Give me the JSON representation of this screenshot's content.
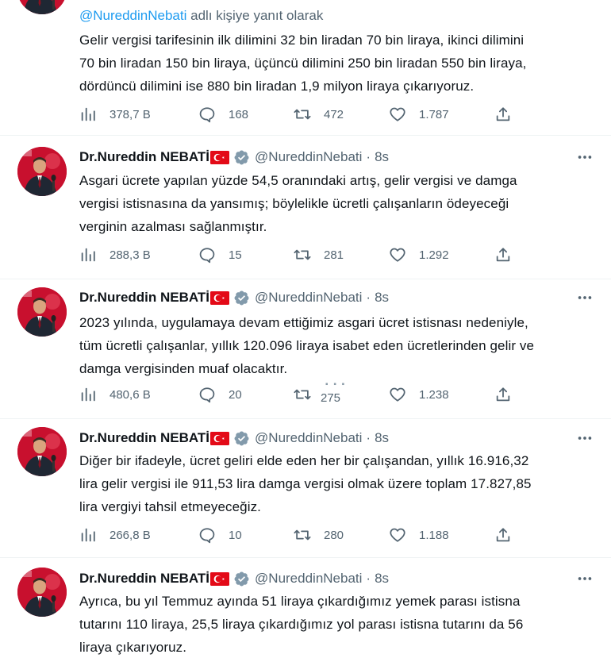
{
  "colors": {
    "accent": "#1d9bf0",
    "verified": "#829aab",
    "secondary_text": "#536471",
    "avatar_bg": "#c8102e",
    "flag_red": "#e30a17"
  },
  "tweets": [
    {
      "reply_to_prefix": "@NureddinNebati",
      "reply_to_suffix": " adlı kişiye yanıt olarak",
      "lines": [
        "Gelir vergisi tarifesinin ilk dilimini 32 bin liradan 70 bin liraya, ikinci dilimini",
        "70 bin liradan 150 bin liraya, üçüncü dilimini 250 bin liradan 550 bin liraya,",
        "dördüncü dilimini ise 880 bin liradan 1,9 milyon liraya çıkarıyoruz."
      ],
      "views": "378,7 B",
      "replies": "168",
      "retweets": "472",
      "likes": "1.787"
    },
    {
      "name": "Dr.Nureddin NEBATİ",
      "handle": "@NureddinNebati",
      "time": "8s",
      "lines": [
        "Asgari ücrete yapılan yüzde 54,5 oranındaki artış, gelir vergisi ve damga",
        "vergisi istisnasına da yansımış; böylelikle ücretli çalışanların ödeyeceği",
        "verginin azalması sağlanmıştır."
      ],
      "views": "288,3 B",
      "replies": "15",
      "retweets": "281",
      "likes": "1.292"
    },
    {
      "name": "Dr.Nureddin NEBATİ",
      "handle": "@NureddinNebati",
      "time": "8s",
      "lines": [
        "2023 yılında, uygulamaya devam ettiğimiz asgari ücret istisnası nedeniyle,",
        "tüm ücretli çalışanlar, yıllık 120.096 liraya isabet eden ücretlerinden gelir ve",
        "damga vergisinden muaf olacaktır."
      ],
      "views": "480,6 B",
      "replies": "20",
      "retweets": "275",
      "likes": "1.238"
    },
    {
      "name": "Dr.Nureddin NEBATİ",
      "handle": "@NureddinNebati",
      "time": "8s",
      "lines": [
        "Diğer bir ifadeyle, ücret geliri elde eden her bir çalışandan, yıllık 16.916,32",
        "lira gelir vergisi ile 911,53 lira damga vergisi olmak üzere toplam 17.827,85",
        "lira vergiyi tahsil etmeyeceğiz."
      ],
      "views": "266,8 B",
      "replies": "10",
      "retweets": "280",
      "likes": "1.188"
    },
    {
      "name": "Dr.Nureddin NEBATİ",
      "handle": "@NureddinNebati",
      "time": "8s",
      "lines": [
        "Ayrıca, bu yıl Temmuz ayında 51 liraya çıkardığımız yemek parası istisna",
        "tutarını 110 liraya, 25,5 liraya çıkardığımız yol parası istisna tutarını da 56",
        "liraya çıkarıyoruz."
      ]
    }
  ]
}
